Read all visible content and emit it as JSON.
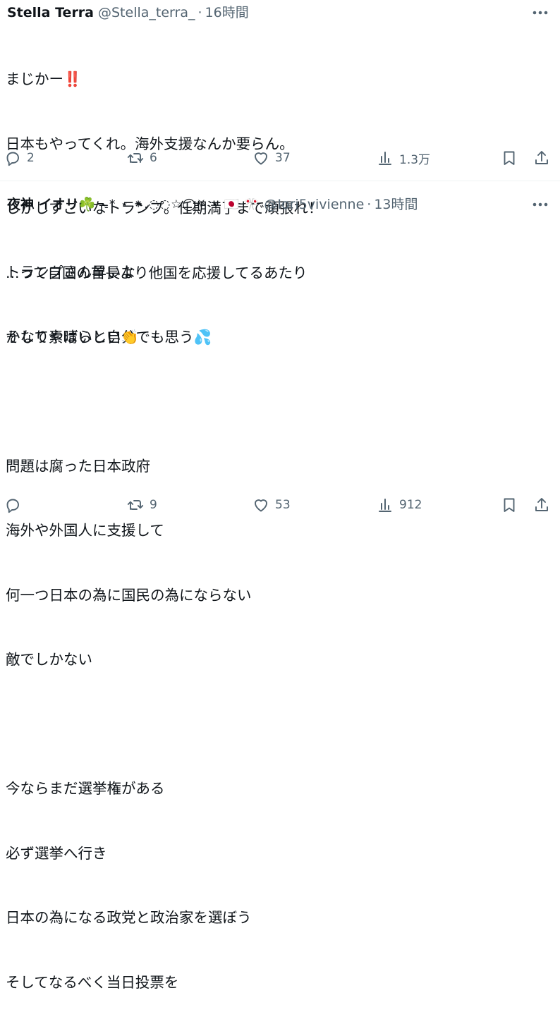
{
  "posts": [
    {
      "name": "Stella Terra",
      "decorations": "",
      "handle": "@Stella_terra_",
      "separator": "·",
      "time": "16時間",
      "lines": [
        "まじかー‼️",
        "日本もやってくれ。海外支援なんか要らん。",
        "しかしすごいなトランプ。任期満了まで頑張れ！",
        "...って自国の首長より他国を応援してるあたり",
        "かなりやばいと自分でも思う💦"
      ],
      "stats": {
        "replies": "2",
        "reposts": "6",
        "likes": "37",
        "views": "1.3万"
      }
    },
    {
      "name": "夜神 イオリ☘️",
      "decorations": "ᯓ* ⋆ ⁕.◌◌☆◯⛧ ⋆ 🇯🇵 🎌",
      "handle": "@Iori5vivienne",
      "separator": "·",
      "time": "13時間",
      "lines": [
        "トランプさん早いな",
        "そして素晴らしい👏",
        "",
        "問題は腐った日本政府",
        "海外や外国人に支援して",
        "何一つ日本の為に国民の為にならない",
        "敵でしかない",
        "",
        "今ならまだ選挙権がある",
        "必ず選挙へ行き",
        "日本の為になる政党と政治家を選ぼう",
        "そしてなるべく当日投票を"
      ],
      "stats": {
        "replies": "",
        "reposts": "9",
        "likes": "53",
        "views": "912"
      }
    }
  ],
  "icons": {
    "more": "more-horizontal-icon",
    "reply": "reply-icon",
    "repost": "repost-icon",
    "like": "heart-icon",
    "views": "views-icon",
    "bookmark": "bookmark-icon",
    "share": "share-icon"
  },
  "colors": {
    "text": "#0f1419",
    "secondary": "#536471",
    "divider": "#eff3f4"
  }
}
